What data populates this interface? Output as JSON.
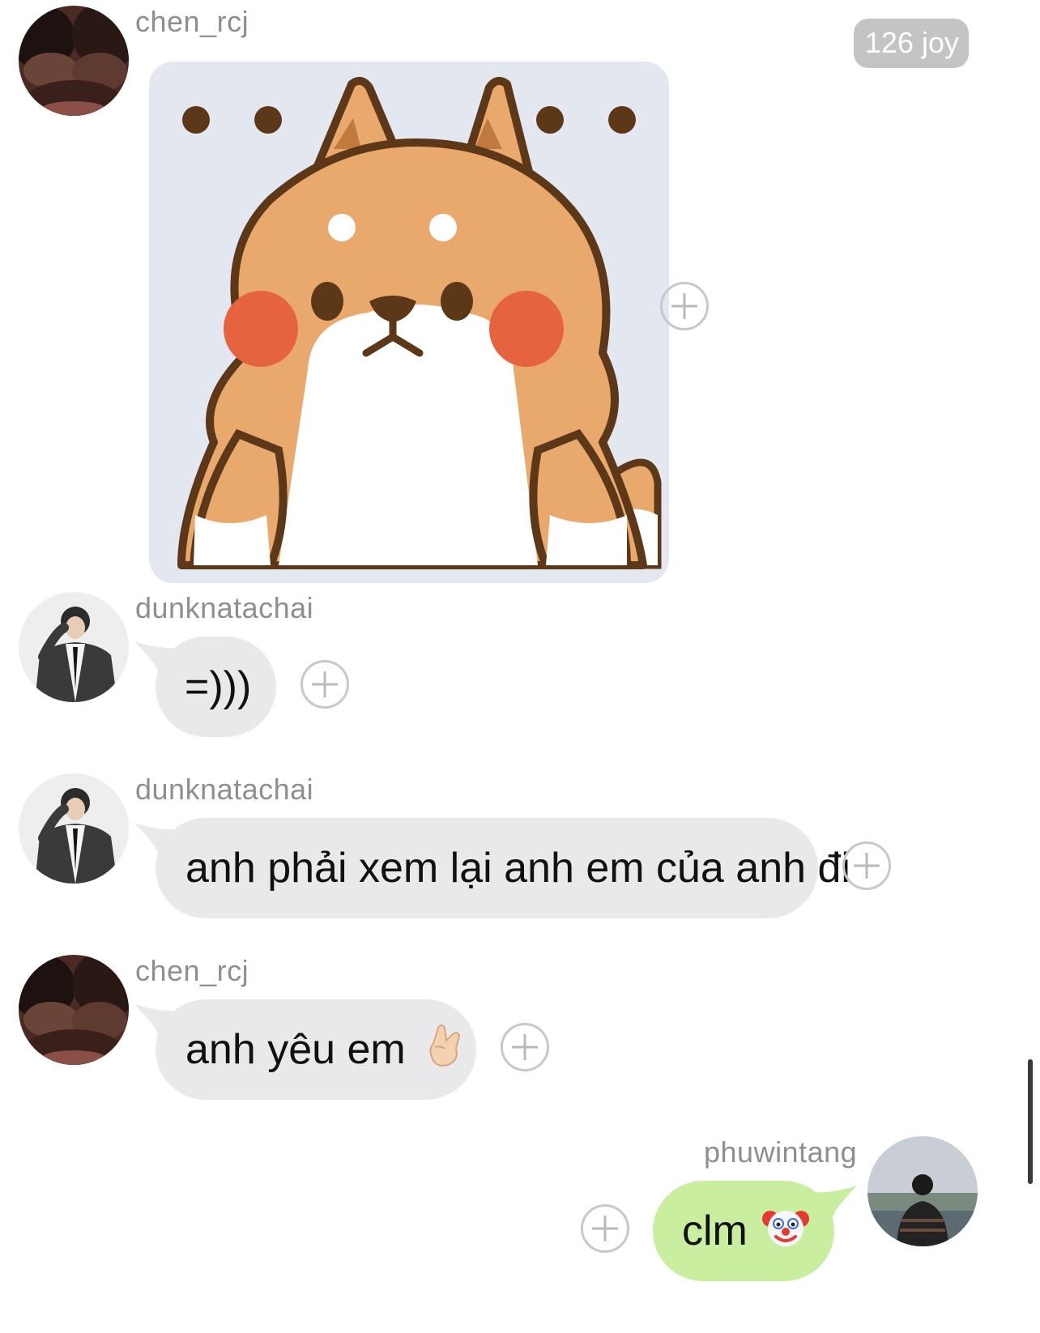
{
  "joy_badge": "126 joy",
  "messages": [
    {
      "username": "chen_rcj",
      "type": "sticker",
      "sticker": "shiba-dog-sticker"
    },
    {
      "username": "dunknatachai",
      "text": "=)))"
    },
    {
      "username": "dunknatachai",
      "text": "anh phải xem lại anh em của anh đi"
    },
    {
      "username": "chen_rcj",
      "text": "anh yêu em",
      "emoji": "finger-heart-emoji"
    },
    {
      "username": "phuwintang",
      "text": "clm",
      "emoji": "clown-face-emoji",
      "outgoing": true
    }
  ],
  "colors": {
    "incoming_bubble": "#e9e9eb",
    "outgoing_bubble": "#c9ee9f",
    "username": "#8e8e93",
    "badge": "#c4c4c6"
  }
}
